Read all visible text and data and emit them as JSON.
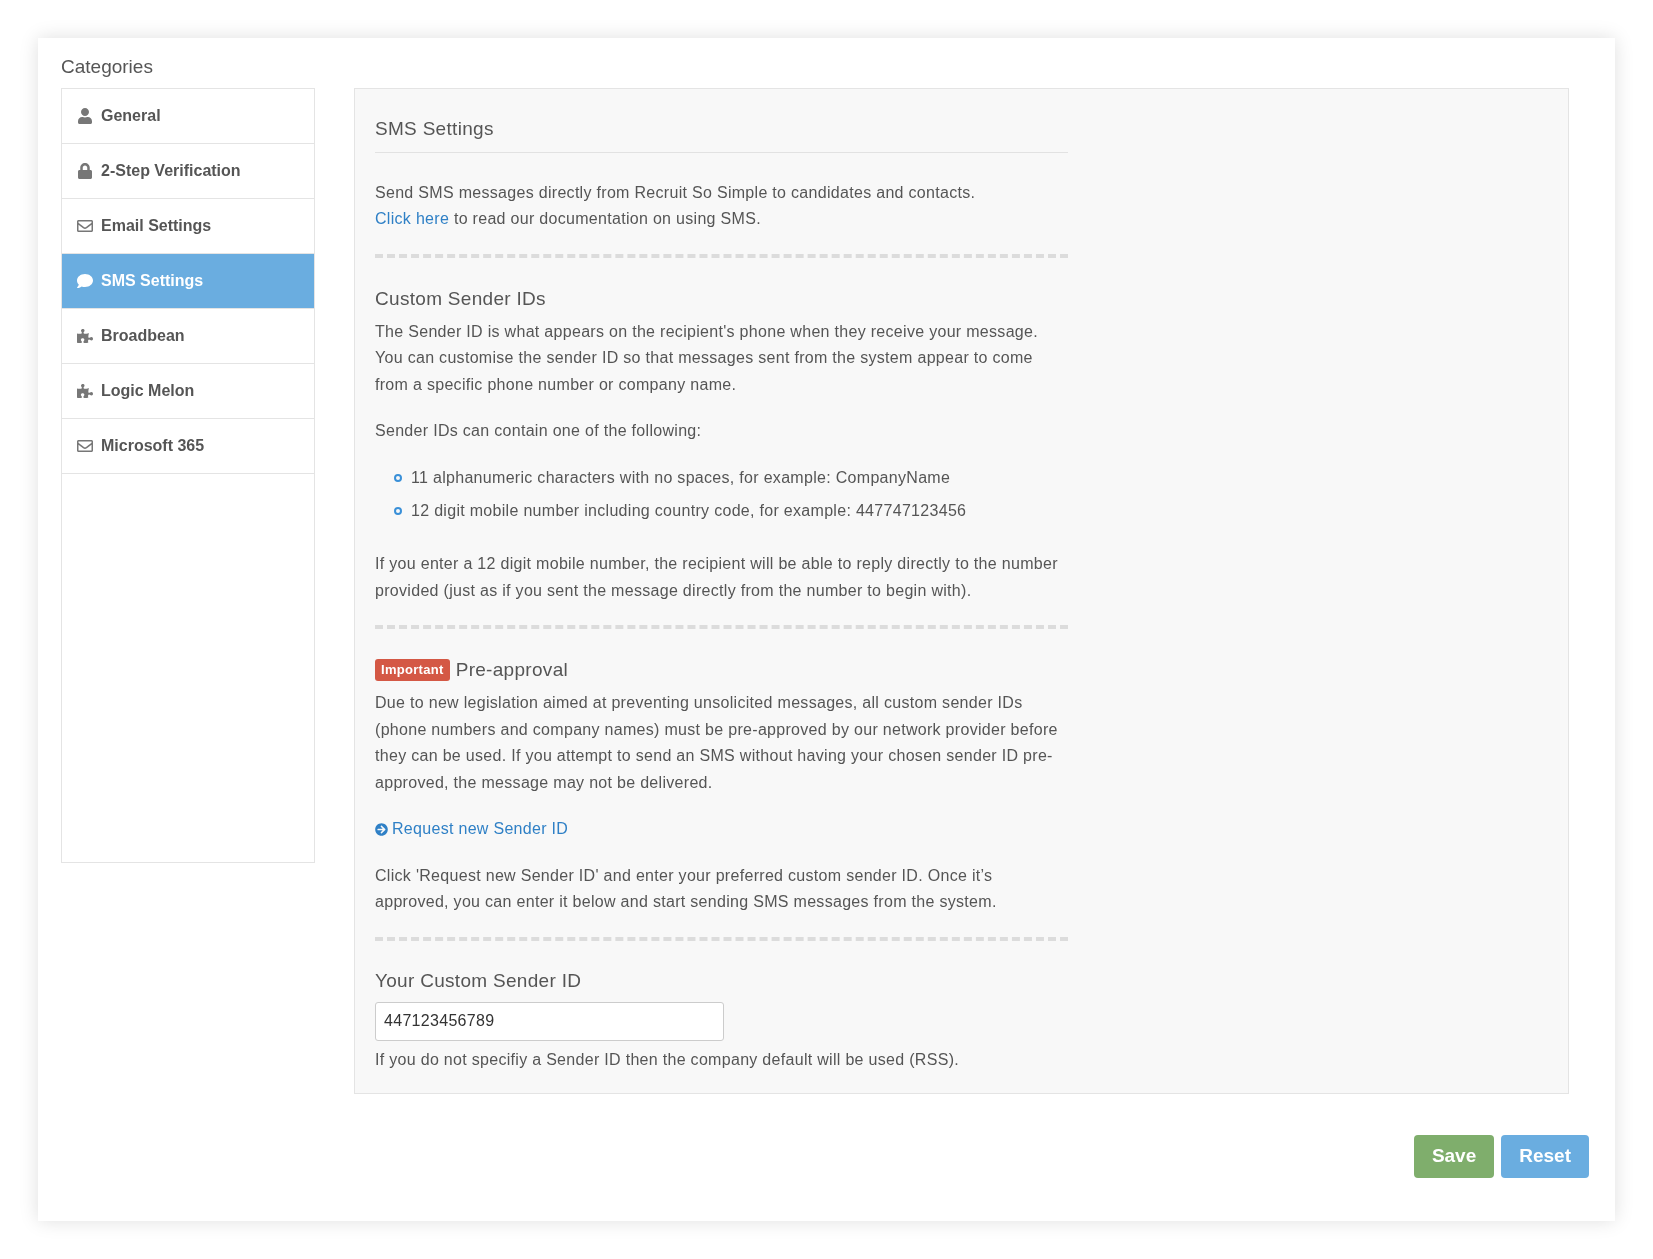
{
  "sidebar": {
    "title": "Categories",
    "items": [
      {
        "label": "General",
        "selected": false
      },
      {
        "label": "2-Step Verification",
        "selected": false
      },
      {
        "label": "Email Settings",
        "selected": false
      },
      {
        "label": "SMS Settings",
        "selected": true
      },
      {
        "label": "Broadbean",
        "selected": false
      },
      {
        "label": "Logic Melon",
        "selected": false
      },
      {
        "label": "Microsoft 365",
        "selected": false
      }
    ]
  },
  "panel": {
    "title": "SMS Settings",
    "intro": {
      "text": "Send SMS messages directly from Recruit So Simple to candidates and contacts.",
      "link": "Click here",
      "after_link": "to read our documentation on using SMS."
    },
    "custom_sender_ids": {
      "heading": "Custom Sender IDs",
      "description": "The Sender ID is what appears on the recipient's phone when they receive your message. You can customise the sender ID so that messages sent from the system appear to come from a specific phone number or company name.",
      "list_intro": "Sender IDs can contain one of the following:",
      "list": [
        "11 alphanumeric characters with no spaces, for example: CompanyName",
        "12 digit mobile number including country code, for example: 447747123456"
      ],
      "note": "If you enter a 12 digit mobile number, the recipient will be able to reply directly to the number provided (just as if you sent the message directly from the number to begin with)."
    },
    "pre_approval": {
      "badge": "Important",
      "heading": "Pre-approval",
      "text": "Due to new legislation aimed at preventing unsolicited messages, all custom sender IDs (phone numbers and company names) must be pre-approved by our network provider before they can be used. If you attempt to send an SMS without having your chosen sender ID pre-approved, the message may not be delivered.",
      "link": "Request new Sender ID",
      "instructions": "Click 'Request new Sender ID' and enter your preferred custom sender ID. Once it’s approved, you can enter it below and start sending SMS messages from the system."
    },
    "sender_id_field": {
      "label": "Your Custom Sender ID",
      "value": "447123456789",
      "help": "If you do not specifiy a Sender ID then the company default will be used (RSS)."
    }
  },
  "buttons": [
    {
      "label": "Save",
      "color": "#7fae6c"
    },
    {
      "label": "Reset",
      "color": "#6aade0"
    }
  ]
}
